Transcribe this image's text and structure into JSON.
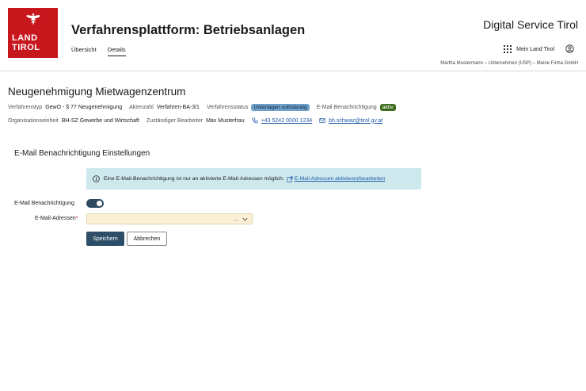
{
  "header": {
    "logo_line1": "LAND",
    "logo_line2": "TIROL",
    "app_title": "Verfahrensplattform: Betriebsanlagen",
    "brand": "Digital Service Tirol",
    "tabs": [
      {
        "label": "Übersicht",
        "active": false
      },
      {
        "label": "Details",
        "active": true
      }
    ],
    "mein_land_tirol": "Mein Land Tirol",
    "user_line": "Martha Mustermann – Unternehmen (USP) – Meine Firma GmbH",
    "icons": {
      "logo": "tirol-eagle-icon",
      "apps": "grid-dots-icon",
      "user": "user-circle-icon"
    }
  },
  "main": {
    "title": "Neugenehmigung Mietwagenzentrum",
    "meta_row1": {
      "verfahrenstyp_label": "Verfahrenstyp",
      "verfahrenstyp_value": "GewO - § 77 Neugenehmigung",
      "aktenzahl_label": "Aktenzahl",
      "aktenzahl_value": "Verfahren-BA-3/1",
      "status_label": "Verfahrensstatus",
      "status_value": "Unterlagen vollständig",
      "email_label": "E-Mail Benachrichtigung",
      "email_value": "aktiv"
    },
    "meta_row2": {
      "org_label": "Organisationseinheit",
      "org_value": "BH-SZ Gewerbe und Wirtschaft",
      "bearbeiter_label": "Zuständiger Bearbeiter",
      "bearbeiter_value": "Max Musterfrau",
      "phone": "+43 5242 0000 1234",
      "email": "bh.schwaz@tirol.gv.at"
    },
    "section_title": "E-Mail Benachrichtigung Einstellungen",
    "info_text": "Eine E-Mail-Benachrichtigung ist nur an aktivierte E-Mail-Adressen möglich:",
    "info_link": "E-Mail Adressen aktivieren/bearbeiten",
    "form": {
      "toggle_label": "E-Mail Benachrichtigung",
      "toggle_on": true,
      "addresses_label": "E-Mail-Adressen",
      "addresses_required": "*",
      "addresses_more": "...",
      "save_label": "Speichern",
      "cancel_label": "Abbrechen"
    },
    "colors": {
      "brand_red": "#c8161d",
      "primary": "#2d4e66",
      "status_badge": "#6ea0c9",
      "aktiv_badge": "#3f6e1f",
      "info_bg": "#cde9ee",
      "select_bg": "#fbf0d5",
      "link": "#1f5aa6"
    }
  }
}
